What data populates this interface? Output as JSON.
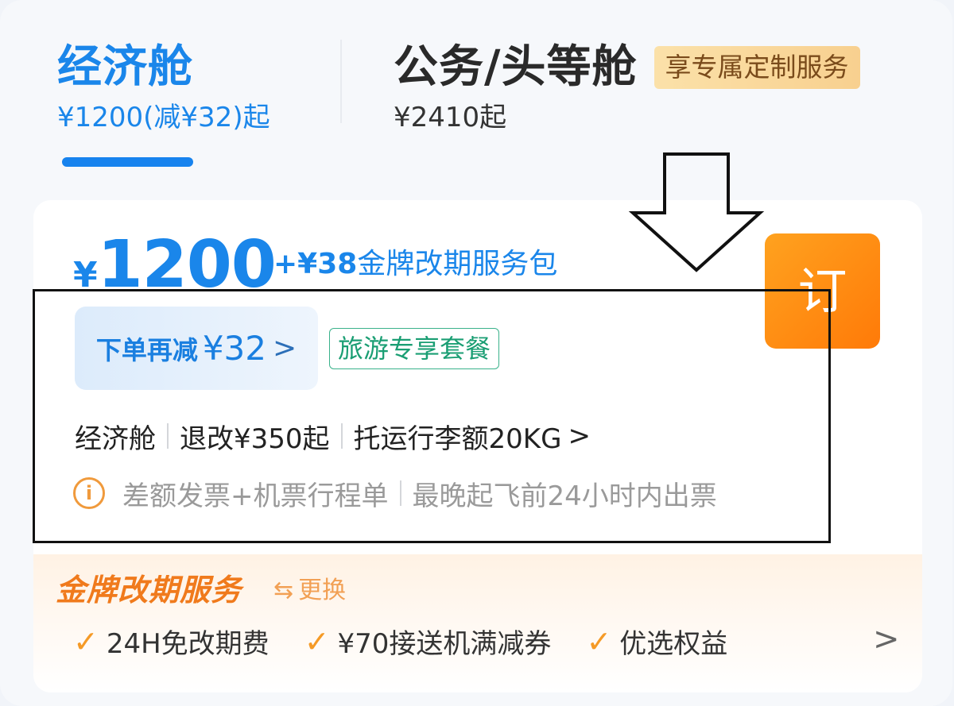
{
  "tabs": {
    "economy": {
      "title": "经济舱",
      "subtitle": "¥1200(减¥32)起"
    },
    "business": {
      "title": "公务/头等舱",
      "subtitle": "¥2410起",
      "badge": "享专属定制服务"
    }
  },
  "offer": {
    "currency": "¥",
    "price": "1200",
    "package": {
      "amount": "+¥38",
      "name": "金牌改期服务包"
    },
    "book_label": "订",
    "discount": {
      "label": "下单再减",
      "amount": "¥32"
    },
    "tag": "旅游专享套餐",
    "info": {
      "cabin": "经济舱",
      "refund": "退改¥350起",
      "baggage": "托运行李额20KG"
    },
    "notice": {
      "invoice": "差额发票+机票行程单",
      "ticketing": "最晚起飞前24小时内出票"
    }
  },
  "gold_service": {
    "title": "金牌改期服务",
    "swap_label": "更换",
    "benefits": [
      "24H免改期费",
      "¥70接送机满减券",
      "优选权益"
    ]
  },
  "colors": {
    "primary_blue": "#1a86ea",
    "orange": "#ff8a12",
    "green": "#1a9e73"
  },
  "icons": {
    "chevron": "chevron-right-icon",
    "info": "info-icon",
    "check": "check-icon",
    "swap": "swap-icon"
  }
}
